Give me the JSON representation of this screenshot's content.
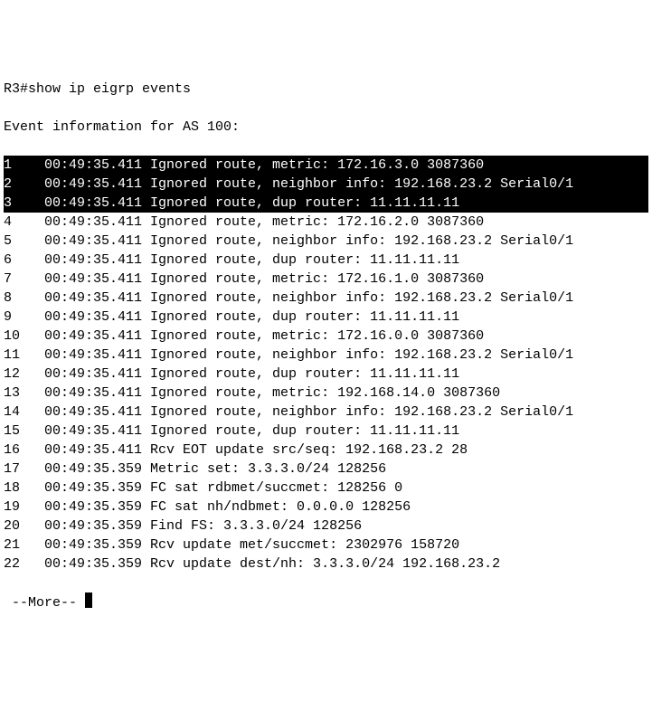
{
  "prompt": "R3#show ip eigrp events",
  "header": "Event information for AS 100:",
  "events": [
    {
      "n": "1",
      "ts": "00:49:35.411",
      "msg": "Ignored route, metric: 172.16.3.0 3087360",
      "hl": true
    },
    {
      "n": "2",
      "ts": "00:49:35.411",
      "msg": "Ignored route, neighbor info: 192.168.23.2 Serial0/1",
      "hl": true
    },
    {
      "n": "3",
      "ts": "00:49:35.411",
      "msg": "Ignored route, dup router: 11.11.11.11",
      "hl": true
    },
    {
      "n": "4",
      "ts": "00:49:35.411",
      "msg": "Ignored route, metric: 172.16.2.0 3087360",
      "hl": false
    },
    {
      "n": "5",
      "ts": "00:49:35.411",
      "msg": "Ignored route, neighbor info: 192.168.23.2 Serial0/1",
      "hl": false
    },
    {
      "n": "6",
      "ts": "00:49:35.411",
      "msg": "Ignored route, dup router: 11.11.11.11",
      "hl": false
    },
    {
      "n": "7",
      "ts": "00:49:35.411",
      "msg": "Ignored route, metric: 172.16.1.0 3087360",
      "hl": false
    },
    {
      "n": "8",
      "ts": "00:49:35.411",
      "msg": "Ignored route, neighbor info: 192.168.23.2 Serial0/1",
      "hl": false
    },
    {
      "n": "9",
      "ts": "00:49:35.411",
      "msg": "Ignored route, dup router: 11.11.11.11",
      "hl": false
    },
    {
      "n": "10",
      "ts": "00:49:35.411",
      "msg": "Ignored route, metric: 172.16.0.0 3087360",
      "hl": false
    },
    {
      "n": "11",
      "ts": "00:49:35.411",
      "msg": "Ignored route, neighbor info: 192.168.23.2 Serial0/1",
      "hl": false
    },
    {
      "n": "12",
      "ts": "00:49:35.411",
      "msg": "Ignored route, dup router: 11.11.11.11",
      "hl": false
    },
    {
      "n": "13",
      "ts": "00:49:35.411",
      "msg": "Ignored route, metric: 192.168.14.0 3087360",
      "hl": false
    },
    {
      "n": "14",
      "ts": "00:49:35.411",
      "msg": "Ignored route, neighbor info: 192.168.23.2 Serial0/1",
      "hl": false
    },
    {
      "n": "15",
      "ts": "00:49:35.411",
      "msg": "Ignored route, dup router: 11.11.11.11",
      "hl": false
    },
    {
      "n": "16",
      "ts": "00:49:35.411",
      "msg": "Rcv EOT update src/seq: 192.168.23.2 28",
      "hl": false
    },
    {
      "n": "17",
      "ts": "00:49:35.359",
      "msg": "Metric set: 3.3.3.0/24 128256",
      "hl": false
    },
    {
      "n": "18",
      "ts": "00:49:35.359",
      "msg": "FC sat rdbmet/succmet: 128256 0",
      "hl": false
    },
    {
      "n": "19",
      "ts": "00:49:35.359",
      "msg": "FC sat nh/ndbmet: 0.0.0.0 128256",
      "hl": false
    },
    {
      "n": "20",
      "ts": "00:49:35.359",
      "msg": "Find FS: 3.3.3.0/24 128256",
      "hl": false
    },
    {
      "n": "21",
      "ts": "00:49:35.359",
      "msg": "Rcv update met/succmet: 2302976 158720",
      "hl": false
    },
    {
      "n": "22",
      "ts": "00:49:35.359",
      "msg": "Rcv update dest/nh: 3.3.3.0/24 192.168.23.2",
      "hl": false
    }
  ],
  "more": " --More-- "
}
